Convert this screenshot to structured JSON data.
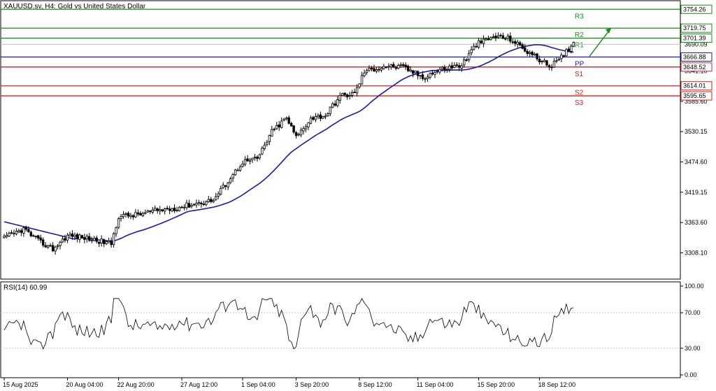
{
  "chart_data": {
    "type": "candlestick",
    "title": "XAUUSD.sv, H4:  Gold vs United States Dollar",
    "price_axis": {
      "ylim": [
        3260,
        3770
      ],
      "ticks": [
        "3308.10",
        "3363.60",
        "3419.15",
        "3474.60",
        "3530.15",
        "3585.60",
        "3641.10"
      ]
    },
    "x_labels": [
      {
        "label": "15 Aug 2025",
        "index": 0
      },
      {
        "label": "20 Aug 04:00",
        "index": 26
      },
      {
        "label": "22 Aug 20:00",
        "index": 47
      },
      {
        "label": "27 Aug 12:00",
        "index": 73
      },
      {
        "label": "1 Sep 04:00",
        "index": 98
      },
      {
        "label": "3 Sep 20:00",
        "index": 120
      },
      {
        "label": "8 Sep 12:00",
        "index": 146
      },
      {
        "label": "11 Sep 04:00",
        "index": 170
      },
      {
        "label": "15 Sep 20:00",
        "index": 195
      },
      {
        "label": "18 Sep 12:00",
        "index": 220
      }
    ],
    "pivot_levels": [
      {
        "name": "R3",
        "value": 3754.26,
        "label": "3754.26",
        "color": "#1a8c1a"
      },
      {
        "name": "R2",
        "value": 3719.75,
        "label": "3719.75",
        "color": "#1a8c1a"
      },
      {
        "name": "R1",
        "value": 3701.39,
        "label": "3701.39",
        "color": "#1a8c1a"
      },
      {
        "name": "PP",
        "value": 3666.88,
        "label": "3666.88",
        "color": "#1a1aa8"
      },
      {
        "name": "S1",
        "value": 3648.52,
        "label": "3648.52",
        "color": "#d42020"
      },
      {
        "name": "S2",
        "value": 3614.01,
        "label": "3614.01",
        "color": "#d42020"
      },
      {
        "name": "S3",
        "value": 3595.65,
        "label": "3595.65",
        "color": "#d42020"
      }
    ],
    "current_price": {
      "value": 3690.09,
      "label": "3690.09"
    },
    "moving_average": {
      "color": "#1a1aa8"
    },
    "forecast_arrow": {
      "color": "#1a8c1a"
    },
    "rsi": {
      "label": "RSI(14) 60.99",
      "ylim": [
        0,
        100
      ],
      "ticks": [
        "100.00",
        "70.00",
        "30.00",
        "0.00"
      ],
      "levels": [
        70,
        30
      ]
    },
    "colors": {
      "bull_body": "#ffffff",
      "bear_body": "#000000",
      "wick": "#000000",
      "grid": "#c8c8c8"
    }
  }
}
